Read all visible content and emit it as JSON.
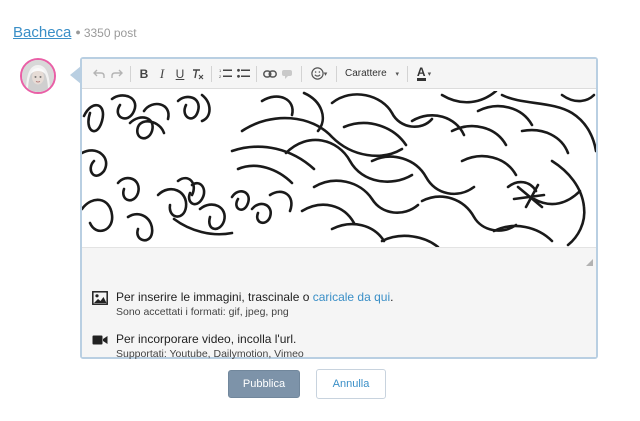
{
  "header": {
    "board_name": "Bacheca",
    "separator": "●",
    "post_count": "3350 post"
  },
  "toolbar": {
    "undo_icon": "undo-icon",
    "redo_icon": "redo-icon",
    "bold": "B",
    "italic": "I",
    "underline": "U",
    "clear_format": "Tx",
    "font_select_label": "Carattere",
    "color_label": "A"
  },
  "info": {
    "image_text": "Per inserire le immagini, trascinale o ",
    "image_link": "caricale da qui",
    "image_text_end": ".",
    "image_formats": "Sono accettati i formati: gif, jpeg, png",
    "video_text": "Per incorporare video, incolla l'url.",
    "video_supported": "Supportati: Youtube, Dailymotion, Vimeo"
  },
  "actions": {
    "publish_label": "Pubblica",
    "cancel_label": "Annulla"
  },
  "colors": {
    "accent": "#3a8fc7",
    "avatar_ring": "#e95fa6",
    "editor_border": "#b9cfe2",
    "publish_bg": "#7d93a9"
  }
}
